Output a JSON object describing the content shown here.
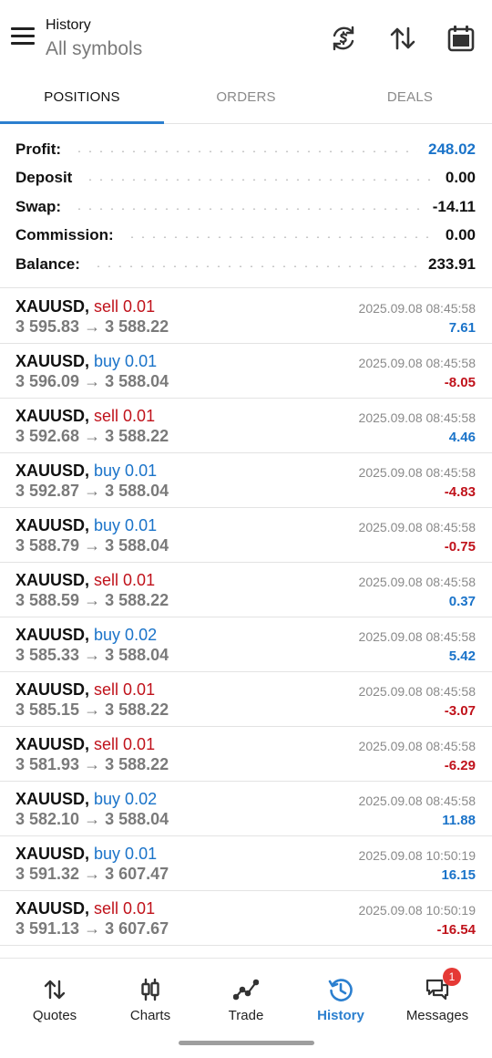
{
  "header": {
    "title_small": "History",
    "title_big": "All symbols",
    "icons": [
      "menu-icon",
      "currency-exchange-icon",
      "sort-icon",
      "calendar-icon"
    ]
  },
  "tabs": [
    {
      "label": "POSITIONS",
      "active": true
    },
    {
      "label": "ORDERS",
      "active": false
    },
    {
      "label": "DEALS",
      "active": false
    }
  ],
  "summary": {
    "profit": {
      "label": "Profit:",
      "value": "248.02"
    },
    "deposit": {
      "label": "Deposit",
      "value": "0.00"
    },
    "swap": {
      "label": "Swap:",
      "value": "-14.11"
    },
    "commission": {
      "label": "Commission:",
      "value": "0.00"
    },
    "balance": {
      "label": "Balance:",
      "value": "233.91"
    }
  },
  "deals": [
    {
      "symbol": "XAUUSD,",
      "side": "sell 0.01",
      "type": "sell",
      "open": "3 595.83",
      "arrow": "→",
      "close": "3 588.22",
      "time": "2025.09.08 08:45:58",
      "profit": "7.61"
    },
    {
      "symbol": "XAUUSD,",
      "side": "buy 0.01",
      "type": "buy",
      "open": "3 596.09",
      "arrow": "→",
      "close": "3 588.04",
      "time": "2025.09.08 08:45:58",
      "profit": "-8.05"
    },
    {
      "symbol": "XAUUSD,",
      "side": "sell 0.01",
      "type": "sell",
      "open": "3 592.68",
      "arrow": "→",
      "close": "3 588.22",
      "time": "2025.09.08 08:45:58",
      "profit": "4.46"
    },
    {
      "symbol": "XAUUSD,",
      "side": "buy 0.01",
      "type": "buy",
      "open": "3 592.87",
      "arrow": "→",
      "close": "3 588.04",
      "time": "2025.09.08 08:45:58",
      "profit": "-4.83"
    },
    {
      "symbol": "XAUUSD,",
      "side": "buy 0.01",
      "type": "buy",
      "open": "3 588.79",
      "arrow": "→",
      "close": "3 588.04",
      "time": "2025.09.08 08:45:58",
      "profit": "-0.75"
    },
    {
      "symbol": "XAUUSD,",
      "side": "sell 0.01",
      "type": "sell",
      "open": "3 588.59",
      "arrow": "→",
      "close": "3 588.22",
      "time": "2025.09.08 08:45:58",
      "profit": "0.37"
    },
    {
      "symbol": "XAUUSD,",
      "side": "buy 0.02",
      "type": "buy",
      "open": "3 585.33",
      "arrow": "→",
      "close": "3 588.04",
      "time": "2025.09.08 08:45:58",
      "profit": "5.42"
    },
    {
      "symbol": "XAUUSD,",
      "side": "sell 0.01",
      "type": "sell",
      "open": "3 585.15",
      "arrow": "→",
      "close": "3 588.22",
      "time": "2025.09.08 08:45:58",
      "profit": "-3.07"
    },
    {
      "symbol": "XAUUSD,",
      "side": "sell 0.01",
      "type": "sell",
      "open": "3 581.93",
      "arrow": "→",
      "close": "3 588.22",
      "time": "2025.09.08 08:45:58",
      "profit": "-6.29"
    },
    {
      "symbol": "XAUUSD,",
      "side": "buy 0.02",
      "type": "buy",
      "open": "3 582.10",
      "arrow": "→",
      "close": "3 588.04",
      "time": "2025.09.08 08:45:58",
      "profit": "11.88"
    },
    {
      "symbol": "XAUUSD,",
      "side": "buy 0.01",
      "type": "buy",
      "open": "3 591.32",
      "arrow": "→",
      "close": "3 607.47",
      "time": "2025.09.08 10:50:19",
      "profit": "16.15"
    },
    {
      "symbol": "XAUUSD,",
      "side": "sell 0.01",
      "type": "sell",
      "open": "3 591.13",
      "arrow": "→",
      "close": "3 607.67",
      "time": "2025.09.08 10:50:19",
      "profit": "-16.54"
    }
  ],
  "bottom_nav": [
    {
      "label": "Quotes",
      "icon": "quotes-icon",
      "active": false
    },
    {
      "label": "Charts",
      "icon": "charts-icon",
      "active": false
    },
    {
      "label": "Trade",
      "icon": "trade-icon",
      "active": false
    },
    {
      "label": "History",
      "icon": "history-icon",
      "active": true
    },
    {
      "label": "Messages",
      "icon": "messages-icon",
      "active": false,
      "badge": "1"
    }
  ],
  "colors": {
    "accent": "#2b7fcf",
    "positive": "#1a73c9",
    "negative": "#c0121b",
    "badge": "#e53935"
  }
}
